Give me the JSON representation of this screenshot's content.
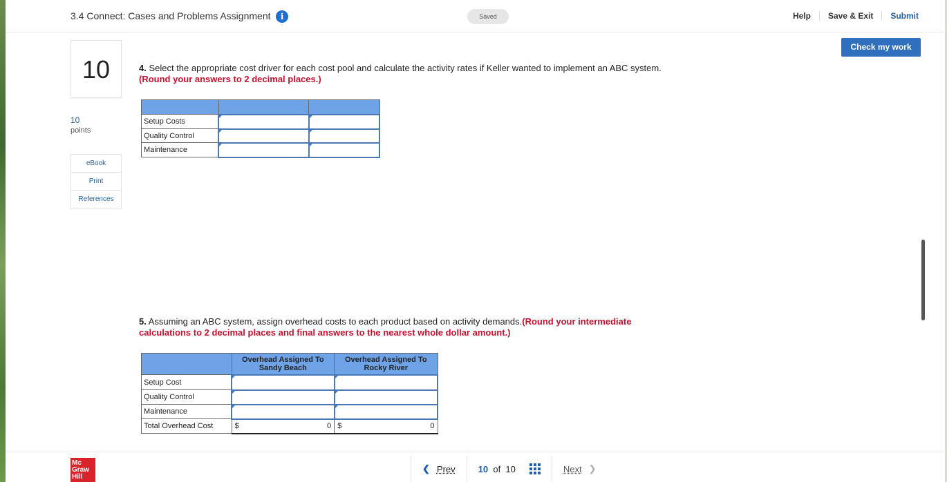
{
  "header": {
    "title": "3.4 Connect: Cases and Problems Assignment",
    "saved": "Saved",
    "help": "Help",
    "save_exit": "Save & Exit",
    "submit": "Submit",
    "check_work": "Check my work"
  },
  "question_panel": {
    "number": "10",
    "points_value": "10",
    "points_label": "points",
    "links": [
      "eBook",
      "Print",
      "References"
    ]
  },
  "part4": {
    "number": "4.",
    "text": " Select the appropriate cost driver for each cost pool and calculate the activity rates if Keller wanted to implement an ABC system.",
    "note": "(Round your answers to 2 decimal places.)",
    "rows": [
      "Setup Costs",
      "Quality Control",
      "Maintenance"
    ]
  },
  "part5": {
    "number": "5.",
    "text": " Assuming an ABC system, assign overhead costs to each product based on activity demands.",
    "note": "(Round your intermediate calculations to 2 decimal places and final answers to the nearest whole dollar amount.)",
    "col1": "Overhead Assigned To Sandy Beach",
    "col2": "Overhead Assigned To Rocky River",
    "rows": [
      "Setup Cost",
      "Quality Control",
      "Maintenance"
    ],
    "total_label": "Total Overhead Cost",
    "currency": "$",
    "total_sandy": "0",
    "total_rocky": "0"
  },
  "footer": {
    "prev": "Prev",
    "current": "10",
    "of": "of",
    "total": "10",
    "next": "Next",
    "logo": [
      "Mc",
      "Graw",
      "Hill"
    ]
  }
}
